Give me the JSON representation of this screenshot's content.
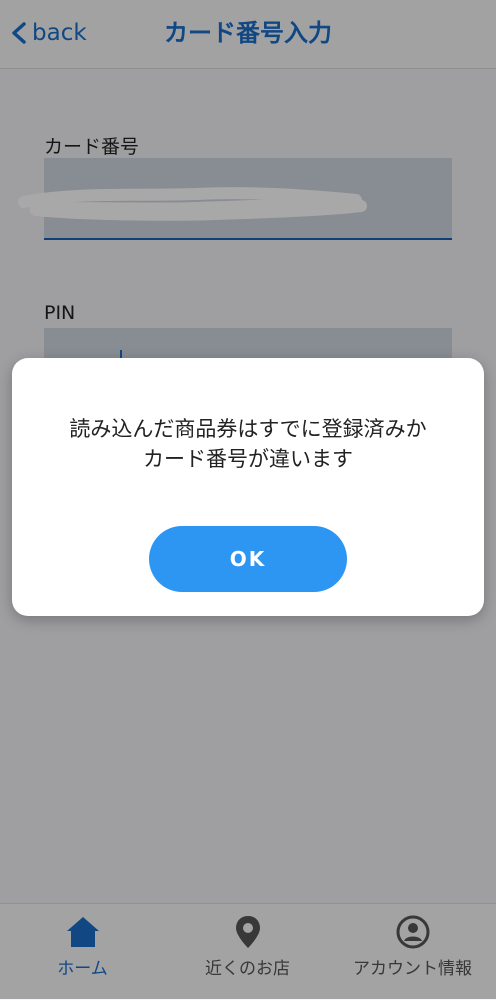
{
  "header": {
    "back_label": "back",
    "title": "カード番号入力"
  },
  "form": {
    "card_number_label": "カード番号",
    "card_number_value": "",
    "pin_label": "PIN",
    "pin_value": ""
  },
  "dialog": {
    "message": "読み込んだ商品券はすでに登録済みか\nカード番号が違います",
    "ok_label": "OK"
  },
  "tabbar": {
    "items": [
      {
        "label": "ホーム",
        "icon": "home-icon",
        "active": true
      },
      {
        "label": "近くのお店",
        "icon": "map-pin-icon",
        "active": false
      },
      {
        "label": "アカウント情報",
        "icon": "account-icon",
        "active": false
      }
    ]
  },
  "colors": {
    "accent": "#1a6ec9",
    "button": "#2d95f2"
  }
}
